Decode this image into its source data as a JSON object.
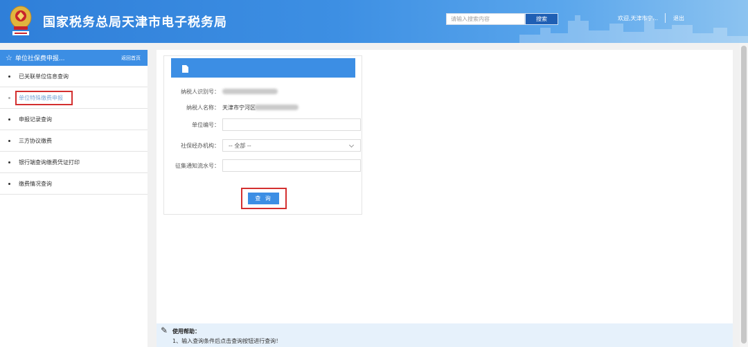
{
  "header": {
    "site_title": "国家税务总局天津市电子税务局",
    "search_placeholder": "请输入搜索内容",
    "search_button": "搜索",
    "welcome": "欢迎,天津市宁...",
    "logout": "退出",
    "emblem_icon": "tax-emblem-icon"
  },
  "sidebar": {
    "title": "单位社保费申报...",
    "back_home": "返回首页",
    "items": [
      {
        "label": "已关联单位信息查询"
      },
      {
        "label": "单位特殊缴费申报"
      },
      {
        "label": "申报记录查询"
      },
      {
        "label": "三方协议缴费"
      },
      {
        "label": "银行端查询缴费凭证打印"
      },
      {
        "label": "缴费情况查询"
      }
    ]
  },
  "form": {
    "taxpayer_id_label": "纳税人识别号：",
    "taxpayer_name_label": "纳税人名称：",
    "taxpayer_name_value": "天津市宁河区",
    "unit_no_label": "单位编号：",
    "agency_label": "社保经办机构：",
    "agency_value": "-- 全部 --",
    "notice_no_label": "征集通知流水号：",
    "query_button": "查 询"
  },
  "help": {
    "title": "使用帮助：",
    "text": "1、输入查询条件后点击查询按钮进行查询！"
  },
  "colors": {
    "header_blue": "#2f7fd9",
    "accent_blue": "#3c8ee4",
    "highlight_red": "#d32f2f"
  }
}
